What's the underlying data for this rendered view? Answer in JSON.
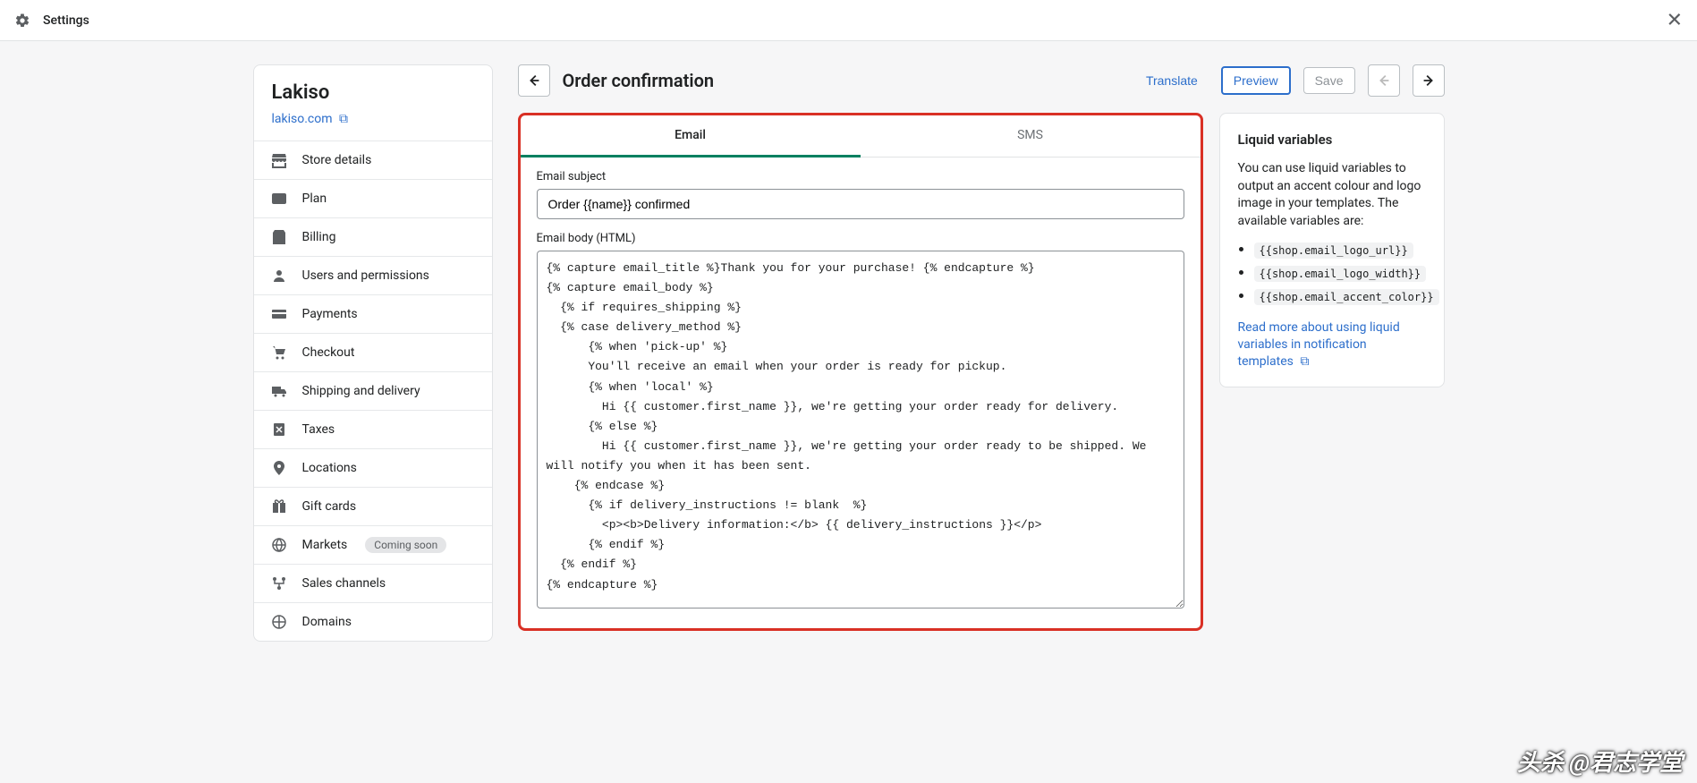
{
  "topbar": {
    "title": "Settings"
  },
  "sidebar": {
    "store_name": "Lakiso",
    "store_url": "lakiso.com",
    "items": [
      {
        "label": "Store details"
      },
      {
        "label": "Plan"
      },
      {
        "label": "Billing"
      },
      {
        "label": "Users and permissions"
      },
      {
        "label": "Payments"
      },
      {
        "label": "Checkout"
      },
      {
        "label": "Shipping and delivery"
      },
      {
        "label": "Taxes"
      },
      {
        "label": "Locations"
      },
      {
        "label": "Gift cards"
      },
      {
        "label": "Markets",
        "badge": "Coming soon"
      },
      {
        "label": "Sales channels"
      },
      {
        "label": "Domains"
      }
    ]
  },
  "header": {
    "title": "Order confirmation",
    "translate": "Translate",
    "preview": "Preview",
    "save": "Save"
  },
  "tabs": {
    "email": "Email",
    "sms": "SMS"
  },
  "form": {
    "subject_label": "Email subject",
    "subject_value": "Order {{name}} confirmed",
    "body_label": "Email body (HTML)",
    "body_value": "{% capture email_title %}Thank you for your purchase! {% endcapture %}\n{% capture email_body %}\n  {% if requires_shipping %}\n  {% case delivery_method %}\n      {% when 'pick-up' %}\n      You'll receive an email when your order is ready for pickup.\n      {% when 'local' %}\n        Hi {{ customer.first_name }}, we're getting your order ready for delivery.\n      {% else %}\n        Hi {{ customer.first_name }}, we're getting your order ready to be shipped. We will notify you when it has been sent.\n    {% endcase %}\n      {% if delivery_instructions != blank  %}\n        <p><b>Delivery information:</b> {{ delivery_instructions }}</p>\n      {% endif %}\n  {% endif %}\n{% endcapture %}"
  },
  "help": {
    "title": "Liquid variables",
    "desc": "You can use liquid variables to output an accent colour and logo image in your templates. The available variables are:",
    "vars": [
      "{{shop.email_logo_url}}",
      "{{shop.email_logo_width}}",
      "{{shop.email_accent_color}}"
    ],
    "link": "Read more about using liquid variables in notification templates"
  },
  "watermark": "头杀 @君志学堂"
}
